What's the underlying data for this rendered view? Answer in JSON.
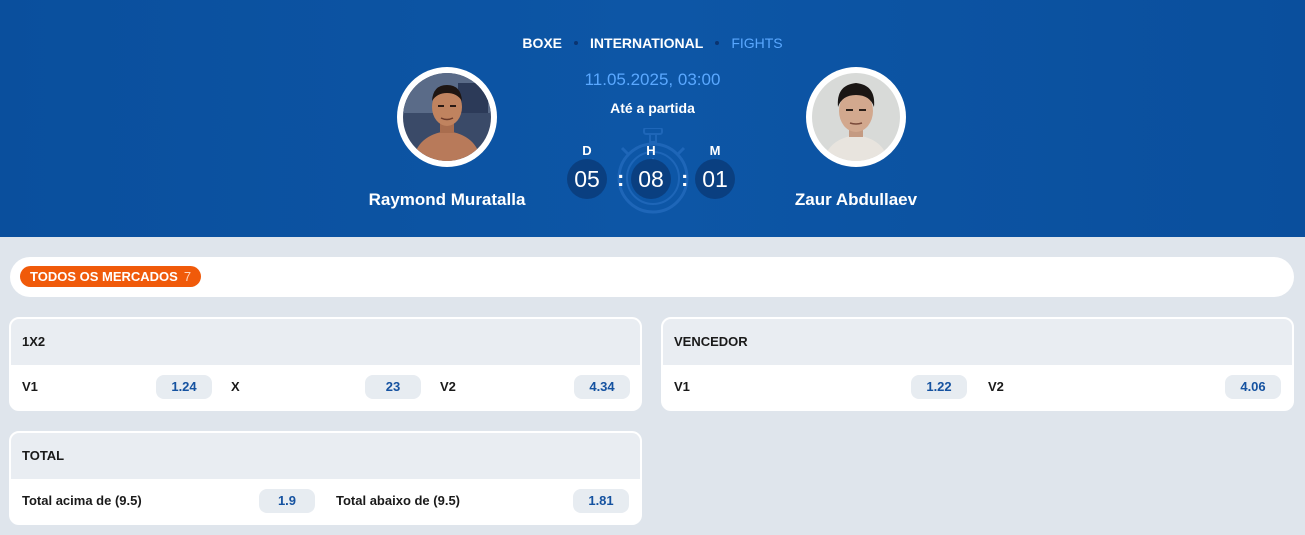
{
  "breadcrumb": {
    "items": [
      "BOXE",
      "INTERNATIONAL",
      "FIGHTS"
    ]
  },
  "event": {
    "date": "11.05.2025, 03:00",
    "until_label": "Até a partida",
    "home_name": "Raymond Muratalla",
    "away_name": "Zaur Abdullaev"
  },
  "countdown": {
    "days_label": "D",
    "days": "05",
    "hours_label": "H",
    "hours": "08",
    "minutes_label": "M",
    "minutes": "01",
    "separator": ":"
  },
  "markets": {
    "all_label": "TODOS OS MERCADOS",
    "count": "7"
  },
  "cards": {
    "x12": {
      "title": "1X2",
      "selections": [
        {
          "label": "V1",
          "odd": "1.24"
        },
        {
          "label": "X",
          "odd": "23"
        },
        {
          "label": "V2",
          "odd": "4.34"
        }
      ]
    },
    "winner": {
      "title": "VENCEDOR",
      "selections": [
        {
          "label": "V1",
          "odd": "1.22"
        },
        {
          "label": "V2",
          "odd": "4.06"
        }
      ]
    },
    "total": {
      "title": "TOTAL",
      "selections": [
        {
          "label": "Total acima de (9.5)",
          "odd": "1.9"
        },
        {
          "label": "Total abaixo de (9.5)",
          "odd": "1.81"
        }
      ]
    }
  },
  "colors": {
    "header_bg": "#0b52a2",
    "accent_blue": "#5aa8ff",
    "accent_orange": "#f05a0a",
    "odd_text": "#1552a0"
  },
  "icons": {
    "timer_bg": "stopwatch-icon",
    "home_avatar": "fighter-avatar",
    "away_avatar": "fighter-avatar"
  }
}
